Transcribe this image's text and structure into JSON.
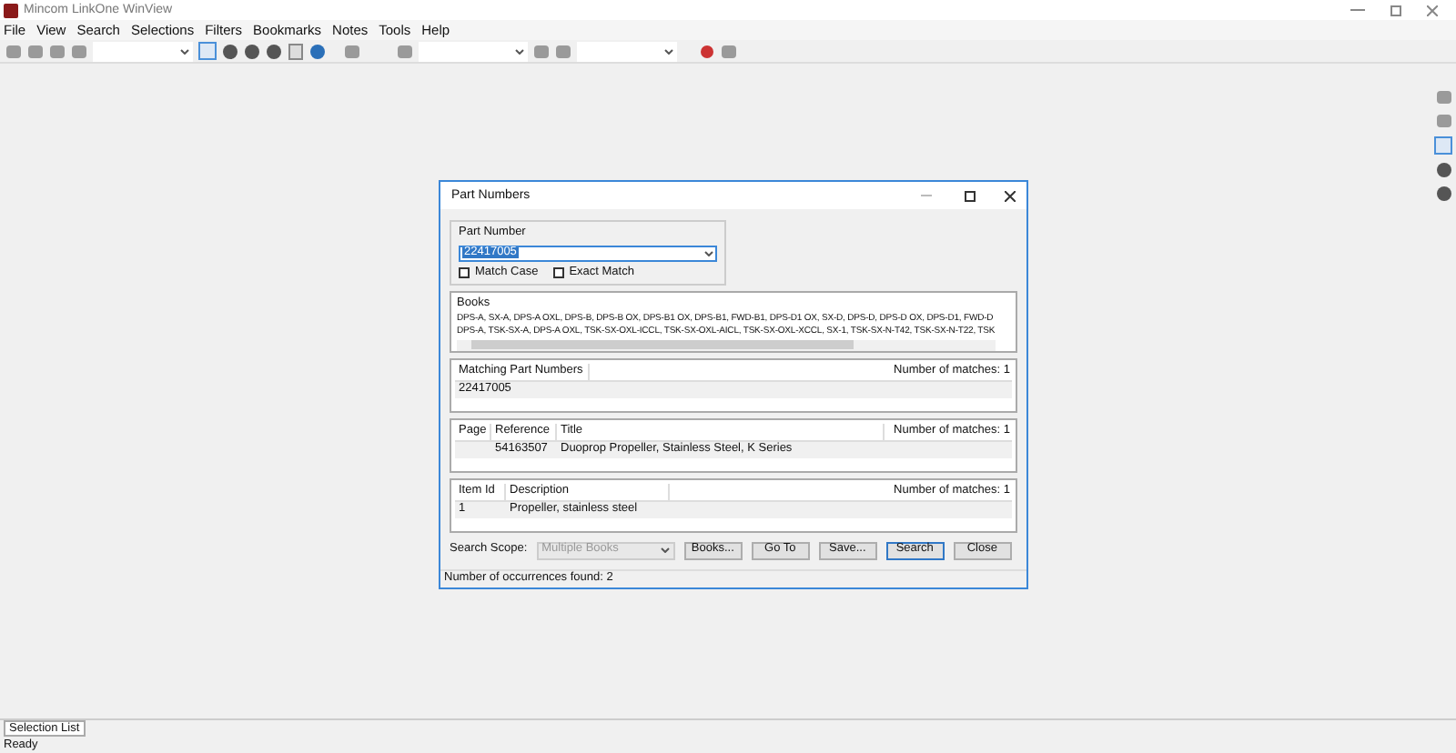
{
  "window": {
    "title": "Mincom LinkOne WinView"
  },
  "menu": [
    "File",
    "View",
    "Search",
    "Selections",
    "Filters",
    "Bookmarks",
    "Notes",
    "Tools",
    "Help"
  ],
  "dialog": {
    "title": "Part Numbers",
    "part_number": {
      "label": "Part Number",
      "value": "22417005"
    },
    "checkboxes": [
      {
        "label": "Match Case",
        "checked": false
      },
      {
        "label": "Exact Match",
        "checked": false
      }
    ],
    "books": {
      "label": "Books",
      "lines": [
        "DPS-A, SX-A, DPS-A OXL, DPS-B, DPS-B OX, DPS-B1 OX, DPS-B1, FWD-B1, DPS-D1 OX, SX-D, DPS-D, DPS-D OX, DPS-D1, FWD-D",
        "DPS-A, TSK-SX-A, DPS-A OXL, TSK-SX-OXL-ICCL, TSK-SX-OXL-AICL, TSK-SX-OXL-XCCL, SX-1, TSK-SX-N-T42, TSK-SX-N-T22, TSK"
      ]
    },
    "grids": [
      {
        "columns": [
          "Matching Part Numbers"
        ],
        "count": "Number of matches: 1",
        "rows": [
          [
            "22417005"
          ]
        ]
      },
      {
        "columns": [
          "Page",
          "Reference",
          "Title"
        ],
        "count": "Number of matches: 1",
        "rows": [
          [
            "",
            "54163507",
            "Duoprop Propeller, Stainless Steel, K Series"
          ]
        ]
      },
      {
        "columns": [
          "Item Id",
          "Description"
        ],
        "count": "Number of matches: 1",
        "rows": [
          [
            "1",
            "Propeller, stainless steel"
          ]
        ]
      }
    ],
    "search_scope": {
      "label": "Search Scope:",
      "value": "Multiple Books",
      "disabled": true
    },
    "buttons": [
      {
        "label": "Books...",
        "default": false
      },
      {
        "label": "Go To",
        "default": false
      },
      {
        "label": "Save...",
        "default": false
      },
      {
        "label": "Search",
        "default": true
      },
      {
        "label": "Close",
        "default": false
      }
    ],
    "status": "Number of occurrences found: 2"
  },
  "tabs": [
    {
      "label": "Selection List",
      "selected": true
    }
  ],
  "status_bar": "Ready"
}
